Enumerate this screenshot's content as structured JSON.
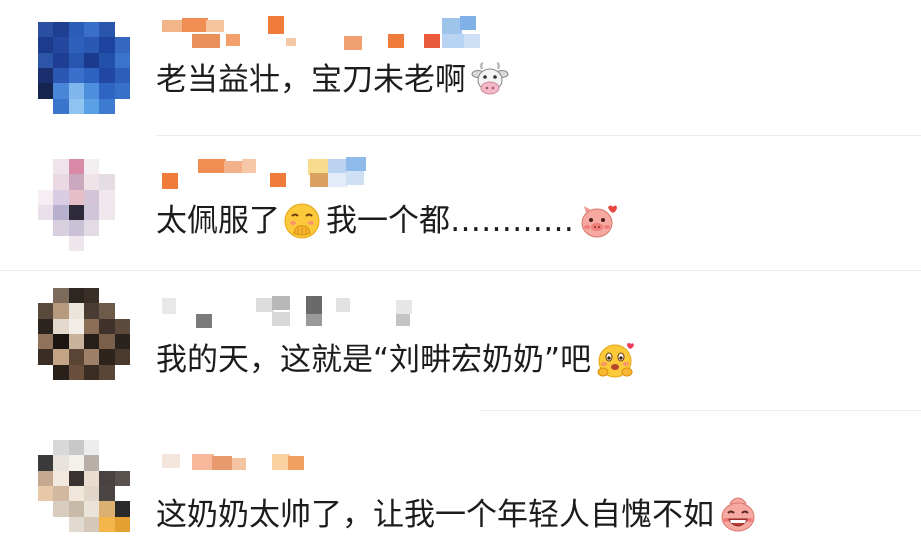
{
  "comments": [
    {
      "text": "老当益壮，宝刀未老啊",
      "emoji": [
        "cow-emoji"
      ]
    },
    {
      "text_before": "太佩服了",
      "text_after": "我一个都…………",
      "emoji": [
        "hand-over-mouth-emoji",
        "blushing-pig-emoji"
      ]
    },
    {
      "text": "我的天，这就是“刘畊宏奶奶”吧",
      "emoji": [
        "heart-eyes-hug-emoji"
      ]
    },
    {
      "text": "这奶奶太帅了，让我一个年轻人自愧不如",
      "emoji": [
        "grinning-pig-emoji"
      ]
    }
  ]
}
